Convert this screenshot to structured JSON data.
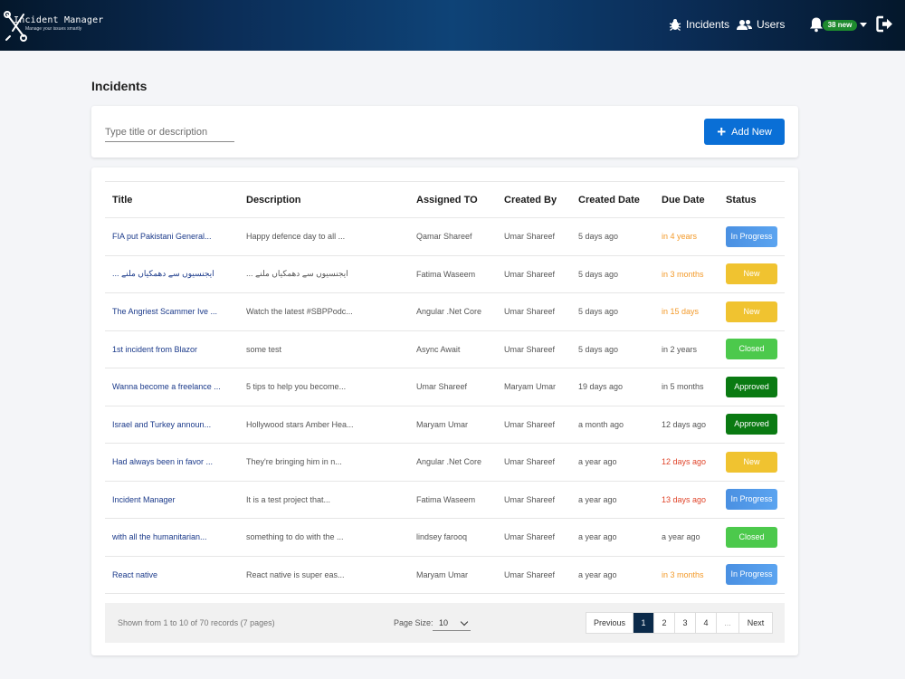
{
  "header": {
    "brand_title": "Incident Manager",
    "brand_subtitle": "Manage your issues smartly",
    "nav": {
      "incidents": "Incidents",
      "users": "Users"
    },
    "notifications_badge": "38 new",
    "icons": {
      "logo": "wrench-logo-icon",
      "incidents": "bug-icon",
      "users": "users-icon",
      "bell": "bell-icon",
      "logout": "logout-icon"
    }
  },
  "page": {
    "title": "Incidents"
  },
  "search": {
    "placeholder": "Type title or description",
    "add_label": "Add New"
  },
  "table": {
    "columns": [
      "Title",
      "Description",
      "Assigned TO",
      "Created By",
      "Created Date",
      "Due Date",
      "Status"
    ],
    "rows": [
      {
        "title": "FIA put Pakistani General...",
        "description": "Happy defence day to all ...",
        "assigned": "Qamar Shareef",
        "created_by": "Umar Shareef",
        "created_date": "5 days ago",
        "due": "in 4 years",
        "due_color": "orange",
        "status": "In Progress"
      },
      {
        "title": "... ایجنسیوں سے دھمکیاں ملنے",
        "description": "... ایجنسیوں سے دھمکیاں ملنے",
        "assigned": "Fatima Waseem",
        "created_by": "Umar Shareef",
        "created_date": "5 days ago",
        "due": "in 3 months",
        "due_color": "orange",
        "status": "New"
      },
      {
        "title": "The Angriest Scammer Ive ...",
        "description": "Watch the latest #SBPPodc...",
        "assigned": "Angular .Net Core",
        "created_by": "Umar Shareef",
        "created_date": "5 days ago",
        "due": "in 15 days",
        "due_color": "orange",
        "status": "New"
      },
      {
        "title": "1st incident from Blazor",
        "description": "some test",
        "assigned": "Async Await",
        "created_by": "Umar Shareef",
        "created_date": "5 days ago",
        "due": "in 2 years",
        "due_color": "normal",
        "status": "Closed"
      },
      {
        "title": "Wanna become a freelance ...",
        "description": "5 tips to help you become...",
        "assigned": "Umar Shareef",
        "created_by": "Maryam Umar",
        "created_date": "19 days ago",
        "due": "in 5 months",
        "due_color": "normal",
        "status": "Approved"
      },
      {
        "title": "Israel and Turkey announ...",
        "description": "Hollywood stars Amber Hea...",
        "assigned": "Maryam Umar",
        "created_by": "Umar Shareef",
        "created_date": "a month ago",
        "due": "12 days ago",
        "due_color": "normal",
        "status": "Approved"
      },
      {
        "title": "Had always been in favor ...",
        "description": "They're bringing him in n...",
        "assigned": "Angular .Net Core",
        "created_by": "Umar Shareef",
        "created_date": "a year ago",
        "due": "12 days ago",
        "due_color": "red",
        "status": "New"
      },
      {
        "title": "Incident Manager",
        "description": "It is a test project that...",
        "assigned": "Fatima Waseem",
        "created_by": "Umar Shareef",
        "created_date": "a year ago",
        "due": "13 days ago",
        "due_color": "red",
        "status": "In Progress"
      },
      {
        "title": "with all the humanitarian...",
        "description": "something to do with the ...",
        "assigned": "lindsey farooq",
        "created_by": "Umar Shareef",
        "created_date": "a year ago",
        "due": "a year ago",
        "due_color": "normal",
        "status": "Closed"
      },
      {
        "title": "React native",
        "description": "React native is super eas...",
        "assigned": "Maryam Umar",
        "created_by": "Umar Shareef",
        "created_date": "a year ago",
        "due": "in 3 months",
        "due_color": "orange",
        "status": "In Progress"
      }
    ]
  },
  "footer": {
    "showing": "Shown from 1 to 10 of 70 records (7 pages)",
    "page_size_label": "Page Size:",
    "page_size": "10",
    "pagination": {
      "previous": "Previous",
      "pages": [
        "1",
        "2",
        "3",
        "4"
      ],
      "ellipsis": "...",
      "next": "Next",
      "current": "1"
    }
  },
  "colors": {
    "primary": "#0a6fd6",
    "in_progress": "#4a90e2",
    "new": "#f0c330",
    "closed": "#4cc94c",
    "approved": "#0a7a12",
    "due_orange": "#f39a2a",
    "due_red": "#e0452b",
    "title_link": "#1b3a8a",
    "active_page": "#0b2a4a"
  }
}
